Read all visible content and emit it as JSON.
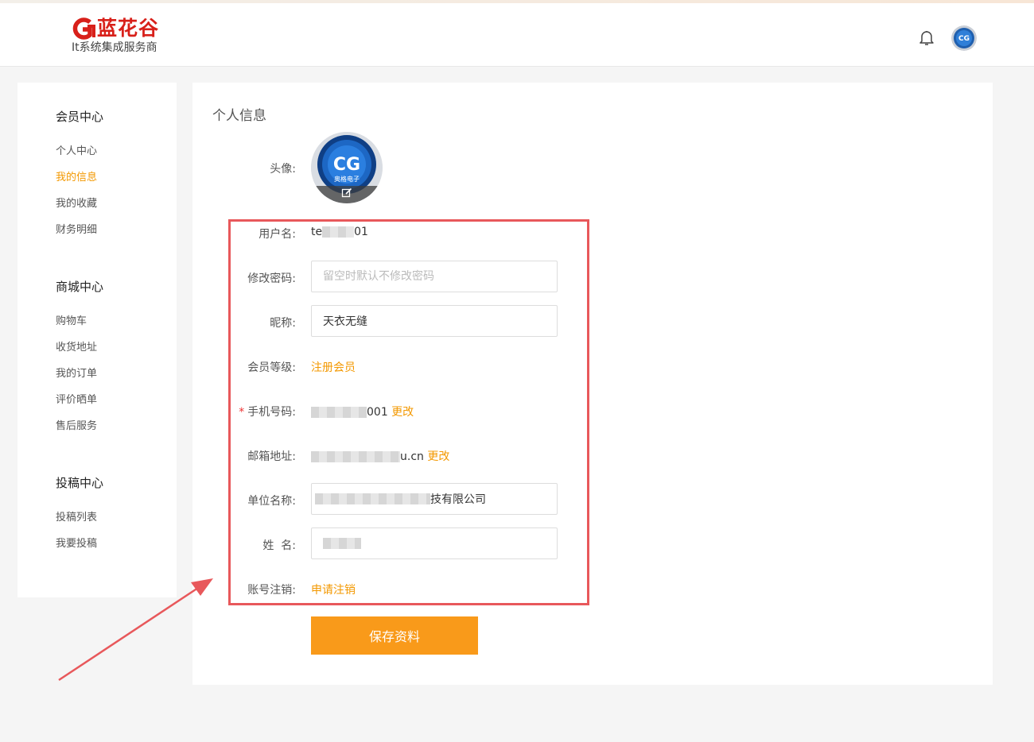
{
  "header": {
    "logo_name": "蓝花谷",
    "logo_sub": "It系统集成服务商",
    "brand_color": "#d8201a"
  },
  "sidebar": {
    "groups": [
      {
        "title": "会员中心",
        "items": [
          "个人中心",
          "我的信息",
          "我的收藏",
          "财务明细"
        ]
      },
      {
        "title": "商城中心",
        "items": [
          "购物车",
          "收货地址",
          "我的订单",
          "评价晒单",
          "售后服务"
        ]
      },
      {
        "title": "投稿中心",
        "items": [
          "投稿列表",
          "我要投稿"
        ]
      }
    ],
    "active_item": "我的信息"
  },
  "main": {
    "title": "个人信息",
    "avatar_label": "头像:",
    "avatar_text": "奥格电子",
    "username_label": "用户名:",
    "username_prefix": "te",
    "username_suffix": "01",
    "password_label": "修改密码:",
    "password_placeholder": "留空时默认不修改密码",
    "nickname_label": "昵称:",
    "nickname_value": "天衣无缝",
    "level_label": "会员等级:",
    "level_value": "注册会员",
    "phone_required": "*",
    "phone_label": "手机号码:",
    "phone_suffix": "001",
    "phone_change": "更改",
    "email_label": "邮箱地址:",
    "email_suffix": "u.cn",
    "email_change": "更改",
    "company_label": "单位名称:",
    "company_suffix": "技有限公司",
    "name_label": "姓  名:",
    "cancel_label": "账号注销:",
    "cancel_link": "申请注销",
    "save_button": "保存资料"
  },
  "colors": {
    "accent": "#f39800",
    "save_button": "#f99a1a",
    "annotation": "#e8585b"
  }
}
